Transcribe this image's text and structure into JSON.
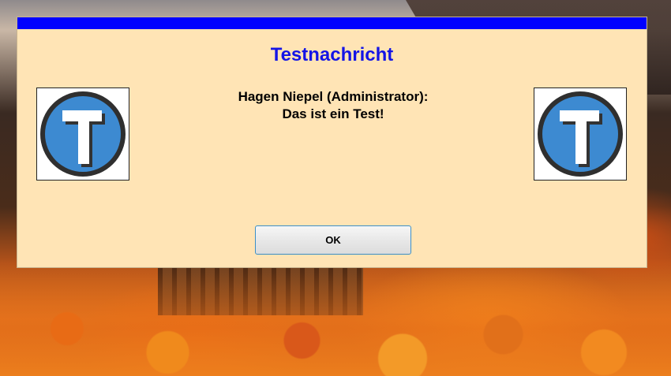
{
  "dialog": {
    "title": "Testnachricht",
    "message_line1": "Hagen Niepel (Administrator):",
    "message_line2": "Das ist ein Test!",
    "ok_label": "OK",
    "title_color": "#1414e6",
    "title_strip_color": "#0000ff",
    "background_color": "#ffe4b5"
  },
  "icons": {
    "left_logo": "t-logo-icon",
    "right_logo": "t-logo-icon"
  }
}
